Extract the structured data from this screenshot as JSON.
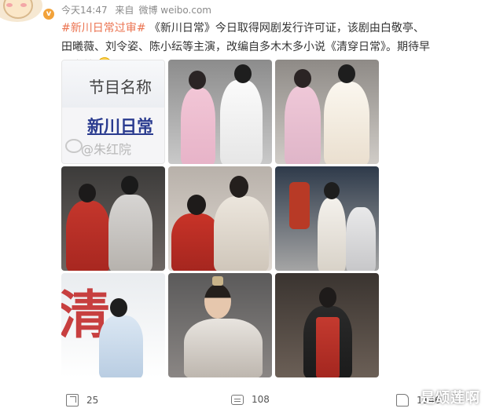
{
  "post": {
    "meta": {
      "time": "今天14:47",
      "source_prefix": "来自",
      "source": "微博 weibo.com"
    },
    "text": {
      "hashtag": "#新川日常过审#",
      "body": " 《新川日常》今日取得网剧发行许可证，该剧由白敬亭、田曦薇、刘令姿、陈小纭等主演，改编自多木木多小说《清穿日常》。期待早日定档"
    },
    "emoji_icon": "crying-face-emoji",
    "photos": {
      "title_card": {
        "heading": "节目名称",
        "show_name": "新川日常",
        "watermark": "@朱红院"
      },
      "calligraphy": "清"
    },
    "actions": {
      "repost_count": "25",
      "comment_count": "108",
      "like_count": "1146"
    },
    "overlay_watermark": "是颂莲啊"
  },
  "colors": {
    "hashtag": "#eb7350",
    "meta": "#8a8a8a",
    "badge": "#f2a23a"
  }
}
